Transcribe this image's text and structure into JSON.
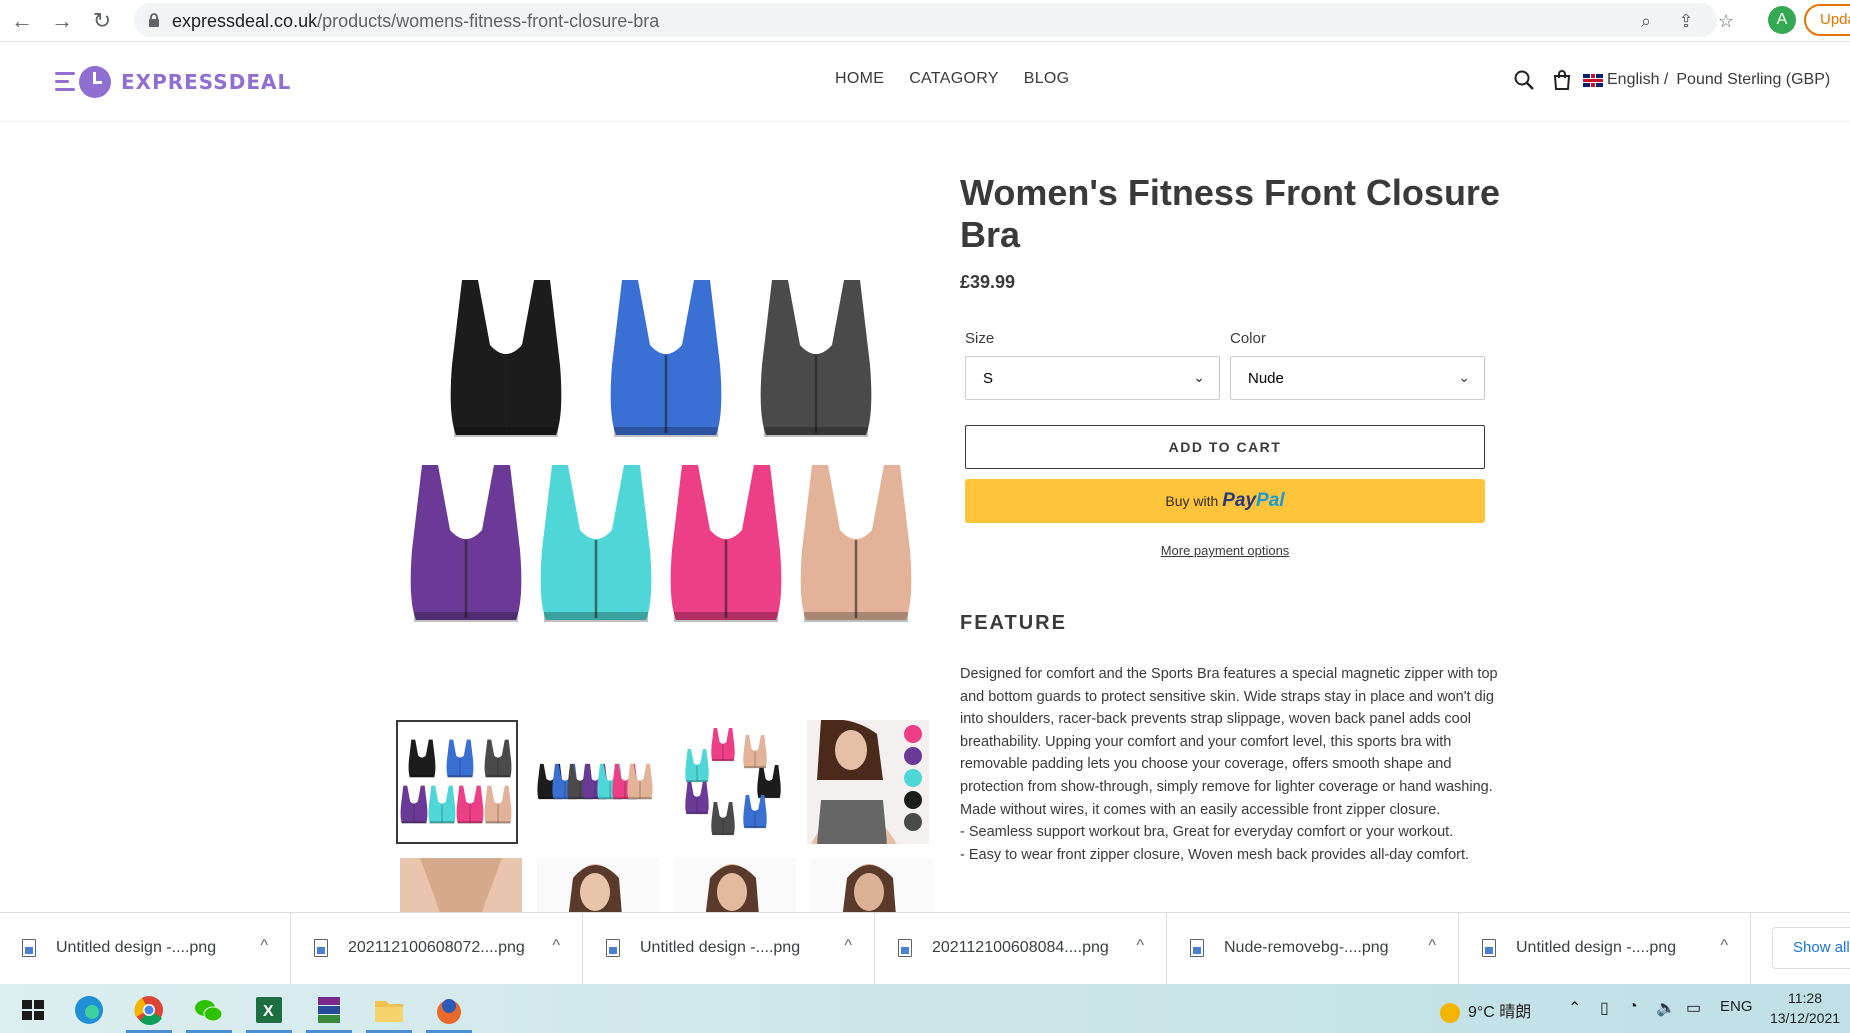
{
  "browser": {
    "url_domain": "expressdeal.co.uk",
    "url_path": "/products/womens-fitness-front-closure-bra",
    "profile_initial": "A",
    "update_label": "Upda"
  },
  "site": {
    "logo_text": "EXPRESSDEAL",
    "nav": [
      "HOME",
      "CATAGORY",
      "BLOG"
    ],
    "language": "English /",
    "currency": "Pound Sterling (GBP)"
  },
  "product": {
    "title": "Women's Fitness Front Closure Bra",
    "price": "£39.99",
    "size_label": "Size",
    "size_value": "S",
    "color_label": "Color",
    "color_value": "Nude",
    "add_to_cart": "ADD TO CART",
    "paypal_prefix": "Buy with",
    "paypal_brand_a": "Pay",
    "paypal_brand_b": "Pal",
    "more_payment": "More payment options",
    "feature_heading": "FEATURE",
    "description": "Designed for comfort and the Sports Bra features a special magnetic zipper with top and bottom guards to protect sensitive skin. Wide straps stay in place and won't dig into shoulders, racer-back prevents strap slippage, woven back panel adds cool breathability. Upping your comfort and your comfort level, this sports bra with removable padding lets you choose your coverage, offers smooth shape and protection from show-through, simply remove for lighter coverage or hand washing. Made without wires, it comes with an easily accessible front zipper closure.",
    "bullet_1": "- Seamless support workout bra, Great for everyday comfort or your workout.",
    "bullet_2": "- Easy to wear front zipper closure, Woven mesh back provides all-day comfort.",
    "colors": [
      "#1c1c1c",
      "#3a6fd4",
      "#4a4a4a",
      "#6a3a96",
      "#4fd6d6",
      "#ec3f86",
      "#e2b398"
    ]
  },
  "downloads": {
    "items": [
      "Untitled design -....png",
      "202112100608072....png",
      "Untitled design -....png",
      "202112100608084....png",
      "Nude-removebg-....png",
      "Untitled design -....png"
    ],
    "show_all": "Show all"
  },
  "taskbar": {
    "weather": "9°C 晴朗",
    "lang": "ENG",
    "time": "11:28",
    "date": "13/12/2021"
  }
}
